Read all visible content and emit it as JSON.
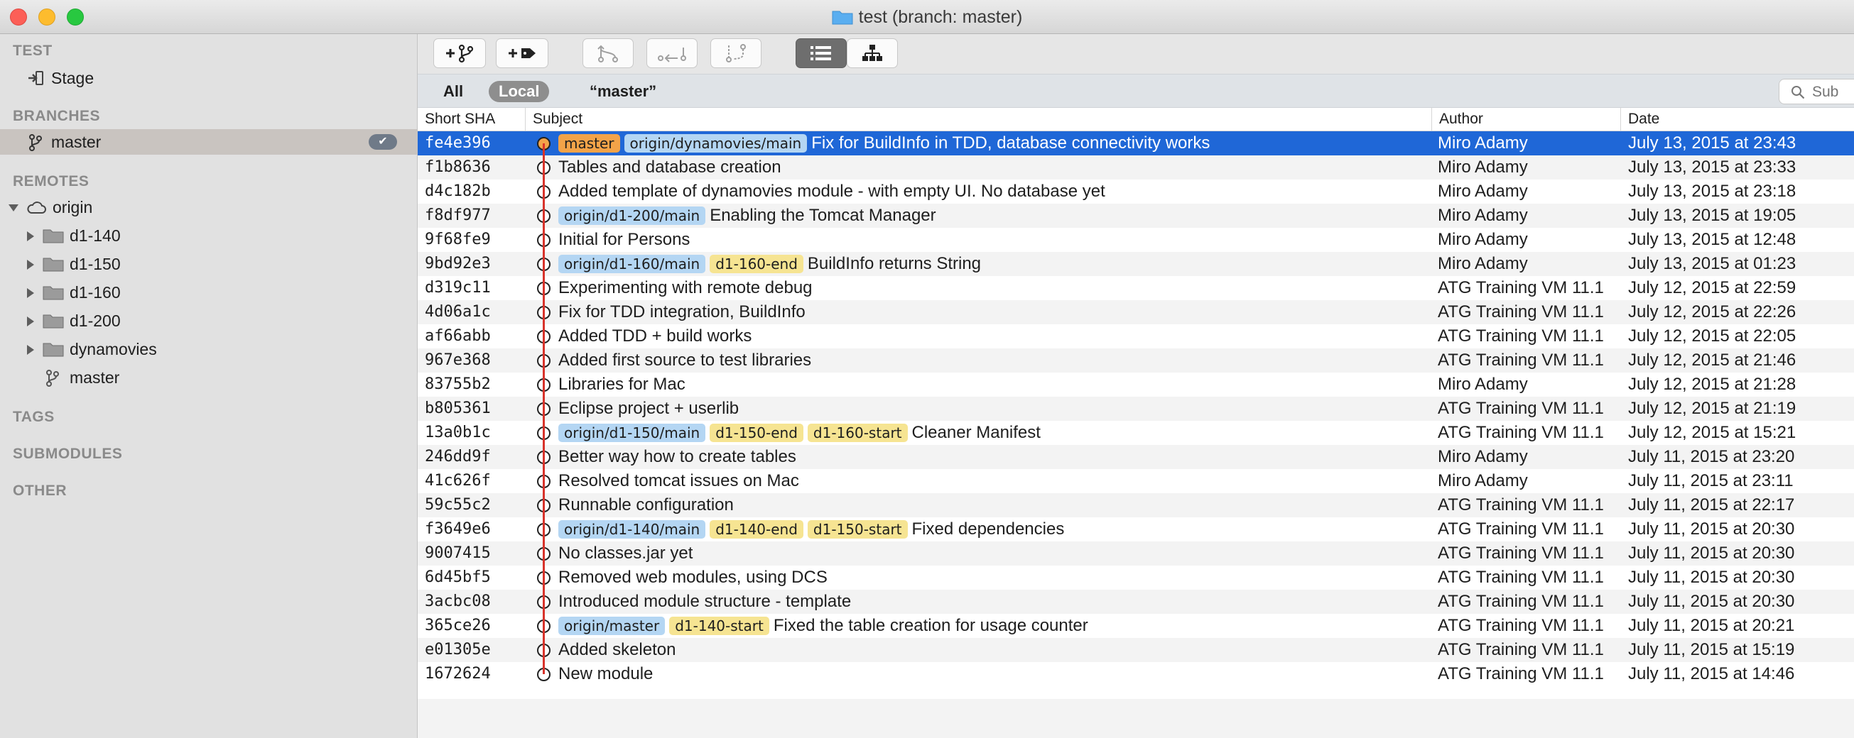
{
  "window": {
    "title": "test (branch: master)"
  },
  "sidebar": {
    "repo_heading": "TEST",
    "stage_label": "Stage",
    "branches_heading": "BRANCHES",
    "current_branch": "master",
    "remotes_heading": "REMOTES",
    "remote_name": "origin",
    "remote_folders": [
      "d1-140",
      "d1-150",
      "d1-160",
      "d1-200",
      "dynamovies"
    ],
    "remote_branch": "master",
    "tags_heading": "TAGS",
    "submodules_heading": "SUBMODULES",
    "other_heading": "OTHER"
  },
  "toolbar": {
    "buttons": [
      "add-branch",
      "add-tag",
      "merge",
      "stash",
      "rebase",
      "list-view",
      "tree-view"
    ]
  },
  "filter": {
    "all_label": "All",
    "local_label": "Local",
    "branch_label": "“master”",
    "search_placeholder": "Sub"
  },
  "table": {
    "columns": [
      "Short SHA",
      "Subject",
      "Author",
      "Date"
    ],
    "rows": [
      {
        "sha": "fe4e396",
        "tags": [
          {
            "t": "master",
            "k": "head"
          },
          {
            "t": "origin/dynamovies/main",
            "k": "remote"
          }
        ],
        "subject": "Fix for BuildInfo in TDD, database connectivity works",
        "author": "Miro Adamy",
        "date": "July 13, 2015 at 23:43"
      },
      {
        "sha": "f1b8636",
        "tags": [],
        "subject": "Tables and database creation",
        "author": "Miro Adamy",
        "date": "July 13, 2015 at 23:33"
      },
      {
        "sha": "d4c182b",
        "tags": [],
        "subject": "Added template of dynamovies module - with empty UI. No database yet",
        "author": "Miro Adamy",
        "date": "July 13, 2015 at 23:18"
      },
      {
        "sha": "f8df977",
        "tags": [
          {
            "t": "origin/d1-200/main",
            "k": "remote"
          }
        ],
        "subject": "Enabling the Tomcat Manager",
        "author": "Miro Adamy",
        "date": "July 13, 2015 at 19:05"
      },
      {
        "sha": "9f68fe9",
        "tags": [],
        "subject": "Initial for Persons",
        "author": "Miro Adamy",
        "date": "July 13, 2015 at 12:48"
      },
      {
        "sha": "9bd92e3",
        "tags": [
          {
            "t": "origin/d1-160/main",
            "k": "remote"
          },
          {
            "t": "d1-160-end",
            "k": "local"
          }
        ],
        "subject": "BuildInfo returns String",
        "author": "Miro Adamy",
        "date": "July 13, 2015 at 01:23"
      },
      {
        "sha": "d319c11",
        "tags": [],
        "subject": "Experimenting with remote debug",
        "author": "ATG Training VM 11.1",
        "date": "July 12, 2015 at 22:59"
      },
      {
        "sha": "4d06a1c",
        "tags": [],
        "subject": "Fix for TDD integration, BuildInfo",
        "author": "ATG Training VM 11.1",
        "date": "July 12, 2015 at 22:26"
      },
      {
        "sha": "af66abb",
        "tags": [],
        "subject": "Added TDD + build works",
        "author": "ATG Training VM 11.1",
        "date": "July 12, 2015 at 22:05"
      },
      {
        "sha": "967e368",
        "tags": [],
        "subject": "Added first source to test libraries",
        "author": "ATG Training VM 11.1",
        "date": "July 12, 2015 at 21:46"
      },
      {
        "sha": "83755b2",
        "tags": [],
        "subject": "Libraries for Mac",
        "author": "Miro Adamy",
        "date": "July 12, 2015 at 21:28"
      },
      {
        "sha": "b805361",
        "tags": [],
        "subject": "Eclipse project + userlib",
        "author": "ATG Training VM 11.1",
        "date": "July 12, 2015 at 21:19"
      },
      {
        "sha": "13a0b1c",
        "tags": [
          {
            "t": "origin/d1-150/main",
            "k": "remote"
          },
          {
            "t": "d1-150-end",
            "k": "local"
          },
          {
            "t": "d1-160-start",
            "k": "local"
          }
        ],
        "subject": "Cleaner Manifest",
        "author": "ATG Training VM 11.1",
        "date": "July 12, 2015 at 15:21"
      },
      {
        "sha": "246dd9f",
        "tags": [],
        "subject": "Better way how to create tables",
        "author": "Miro Adamy",
        "date": "July 11, 2015 at 23:20"
      },
      {
        "sha": "41c626f",
        "tags": [],
        "subject": "Resolved tomcat issues on Mac",
        "author": "Miro Adamy",
        "date": "July 11, 2015 at 23:11"
      },
      {
        "sha": "59c55c2",
        "tags": [],
        "subject": "Runnable configuration",
        "author": "ATG Training VM 11.1",
        "date": "July 11, 2015 at 22:17"
      },
      {
        "sha": "f3649e6",
        "tags": [
          {
            "t": "origin/d1-140/main",
            "k": "remote"
          },
          {
            "t": "d1-140-end",
            "k": "local"
          },
          {
            "t": "d1-150-start",
            "k": "local"
          }
        ],
        "subject": "Fixed dependencies",
        "author": "ATG Training VM 11.1",
        "date": "July 11, 2015 at 20:30"
      },
      {
        "sha": "9007415",
        "tags": [],
        "subject": "No classes.jar yet",
        "author": "ATG Training VM 11.1",
        "date": "July 11, 2015 at 20:30"
      },
      {
        "sha": "6d45bf5",
        "tags": [],
        "subject": "Removed web modules, using DCS",
        "author": "ATG Training VM 11.1",
        "date": "July 11, 2015 at 20:30"
      },
      {
        "sha": "3acbc08",
        "tags": [],
        "subject": "Introduced module structure - template",
        "author": "ATG Training VM 11.1",
        "date": "July 11, 2015 at 20:30"
      },
      {
        "sha": "365ce26",
        "tags": [
          {
            "t": "origin/master",
            "k": "remote"
          },
          {
            "t": "d1-140-start",
            "k": "local"
          }
        ],
        "subject": "Fixed the table creation for usage counter",
        "author": "ATG Training VM 11.1",
        "date": "July 11, 2015 at 20:21"
      },
      {
        "sha": "e01305e",
        "tags": [],
        "subject": "Added skeleton",
        "author": "ATG Training VM 11.1",
        "date": "July 11, 2015 at 15:19"
      },
      {
        "sha": "1672624",
        "tags": [],
        "subject": "New module",
        "author": "ATG Training VM 11.1",
        "date": "July 11, 2015 at 14:46"
      }
    ]
  },
  "colors": {
    "selection": "#1f67d7",
    "remote_tag": "#b4d6f3",
    "local_tag": "#f6e492",
    "head_tag": "#f3a348",
    "graph_line": "#d8332b"
  }
}
